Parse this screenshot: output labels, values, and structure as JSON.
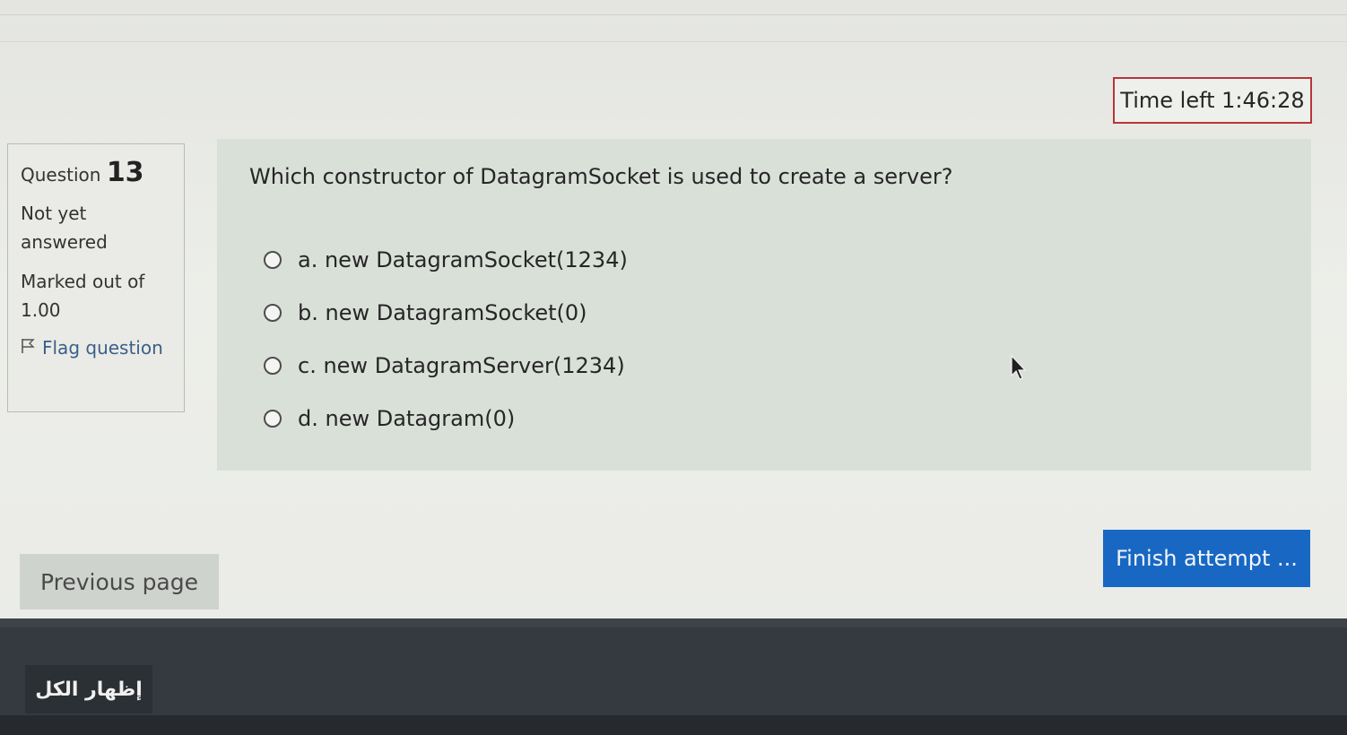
{
  "timer": {
    "label": "Time left 1:46:28"
  },
  "info": {
    "question_label": "Question",
    "question_number": "13",
    "state": "Not yet answered",
    "grade": "Marked out of 1.00",
    "flag_label": "Flag question"
  },
  "question": {
    "text": "Which constructor of DatagramSocket is used to create a server?",
    "answers": [
      "a. new DatagramSocket(1234)",
      "b. new DatagramSocket(0)",
      "c. new DatagramServer(1234)",
      "d. new Datagram(0)"
    ]
  },
  "nav": {
    "previous_label": "Previous page",
    "finish_label": "Finish attempt ..."
  },
  "footer": {
    "show_all_label": "إظهار الكل"
  },
  "colors": {
    "finish_button": "#1868c3",
    "timer_border": "#b9343a",
    "question_panel": "#d9e0d8",
    "footer": "#343a40"
  }
}
